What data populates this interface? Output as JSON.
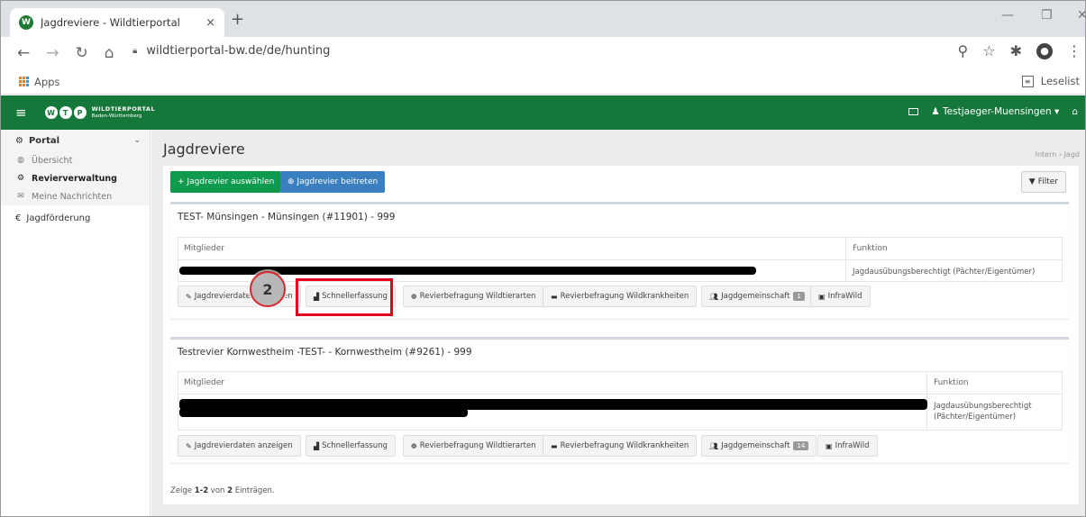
{
  "browser": {
    "tab_title": "Jagdreviere - Wildtierportal",
    "favicon_label": "W",
    "tab_close": "×",
    "new_tab": "+",
    "url": "wildtierportal-bw.de/de/hunting",
    "apps_label": "Apps",
    "reading_list_label": "Leselist"
  },
  "header": {
    "logo_line1": "WILDTIERPORTAL",
    "logo_line2": "Baden-Württemberg",
    "user_name": "Testjaeger-Muensingen ▾"
  },
  "sidebar": {
    "portal_label": "Portal",
    "items": [
      {
        "label": "Übersicht"
      },
      {
        "label": "Revierverwaltung"
      },
      {
        "label": "Meine Nachrichten"
      }
    ],
    "jagdfoerderung_label": "Jagdförderung"
  },
  "main": {
    "title": "Jagdreviere",
    "breadcrumb": "Intern  ›  Jagd",
    "btn_select": "Jagdrevier auswählen",
    "btn_join": "Jagdrevier beitreten",
    "btn_filter": "Filter",
    "footer_prefix": "Zeige ",
    "footer_range": "1-2",
    "footer_mid": " von ",
    "footer_total": "2",
    "footer_suffix": " Einträgen."
  },
  "reviere": [
    {
      "title": "TEST- Münsingen - Münsingen (#11901) - 999",
      "col_members": "Mitglieder",
      "col_function": "Funktion",
      "function_value": "Jagdausübungsberechtigt (Pächter/Eigentümer)",
      "actions": {
        "daten": "Jagdrevierdaten anzeigen",
        "schnell": "Schnellerfassung",
        "wildtierarten": "Revierbefragung Wildtierarten",
        "wildkrankheiten": "Revierbefragung Wildkrankheiten",
        "gemeinschaft": "Jagdgemeinschaft",
        "gemeinschaft_badge": "1",
        "infrawild": "InfraWild"
      }
    },
    {
      "title": "Testrevier Kornwestheim -TEST- - Kornwestheim (#9261) - 999",
      "col_members": "Mitglieder",
      "col_function": "Funktion",
      "function_value_1": "Jagdausübungsberechtigt",
      "function_value_2": "(Pächter/Eigentümer)",
      "actions": {
        "daten": "Jagdrevierdaten anzeigen",
        "schnell": "Schnellerfassung",
        "wildtierarten": "Revierbefragung Wildtierarten",
        "wildkrankheiten": "Revierbefragung Wildkrankheiten",
        "gemeinschaft": "Jagdgemeinschaft",
        "gemeinschaft_badge": "14",
        "infrawild": "InfraWild"
      }
    }
  ],
  "annotation": {
    "step_number": "2",
    "highlight_color": "#e3001b"
  },
  "colors": {
    "header_green": "#15783a",
    "button_green": "#0f9a4d",
    "button_blue": "#3a7fbf"
  }
}
